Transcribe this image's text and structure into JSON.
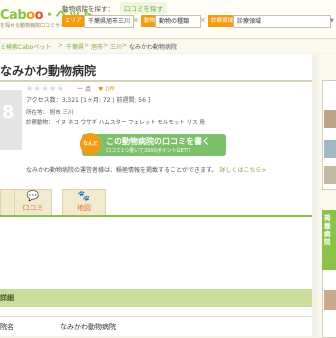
{
  "header": {
    "logo_parts": [
      "C",
      "a",
      "b",
      "o",
      "o",
      "・ペット"
    ],
    "tagline": "を探せる動物病院口コミサイト",
    "search_label": "動物病院を探す：",
    "kuchikomi_tab": "口コミを探す",
    "area_tag": "エリア",
    "area_value": "千葉県旭市三川",
    "animal_tag": "動物",
    "animal_value": "動物の種類",
    "category_tag": "診療領域",
    "category_value": "診療領域",
    "clear": "×",
    "dropdown": "▼"
  },
  "breadcrumb": {
    "home": "ミ検索Caboペット",
    "sep": ">",
    "pref": "千葉県",
    "city": "旭市",
    "area": "三川",
    "current": "なみかわ動物病院"
  },
  "hospital": {
    "title": "なみかわ動物病院",
    "photo_char": "8",
    "stars": "★★★★★",
    "score": "点",
    "score_dash": "ー",
    "likes": "♥ 0件",
    "access": "アクセス数：3,321 [1ヶ月: 72 | 前週間: 56 ]",
    "address_label": "所在地：",
    "address": "旭市 三川",
    "animals_label": "診察動物：",
    "animals": "イヌ ネコ ウサギ ハムスター フェレット モルモット リス 鳥",
    "notice": "なみかわ動物病院の運営者様は、積極情報を掲載することができます。",
    "notice_link": "詳しくはこちら>"
  },
  "cta": {
    "badge": "なんと",
    "main": "この動物病院の口コミを書く",
    "sub": "口コミ1つ書いて3000ポイントGET!!"
  },
  "tabs": [
    {
      "icon": "🐾",
      "label": ""
    },
    {
      "icon": "💬",
      "label": "口コミ"
    },
    {
      "icon": "🐾",
      "label": "地図"
    }
  ],
  "detail": {
    "section_label": "詳細",
    "name_key": "院名",
    "name_val": "なみかわ動物病院"
  },
  "sidebar": {
    "head": "掲載病院"
  },
  "colors": {
    "accent": "#8bc34a",
    "orange": "#f39c12",
    "cta": "#7dc06a"
  }
}
